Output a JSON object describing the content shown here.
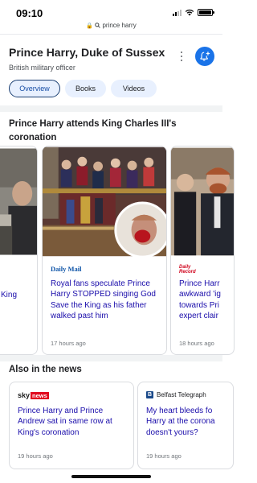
{
  "status_bar": {
    "time": "09:10",
    "battery_level": 1.0
  },
  "url_bar": {
    "query": "prince harry",
    "lock_glyph": "🔒"
  },
  "entity": {
    "title": "Prince Harry, Duke of Sussex",
    "subtitle": "British military officer",
    "chips": [
      {
        "label": "Overview",
        "selected": true
      },
      {
        "label": "Books",
        "selected": false
      },
      {
        "label": "Videos",
        "selected": false
      }
    ]
  },
  "top_stories": {
    "heading": "Prince Harry attends King Charles III's coronation",
    "cards": [
      {
        "source": "",
        "headline": "King",
        "time": ""
      },
      {
        "source": "Daily Mail",
        "headline": "Royal fans speculate Prince Harry STOPPED singing God Save the King as his father walked past him",
        "time": "17 hours ago"
      },
      {
        "source": "Daily Record",
        "source_line1": "Daily",
        "source_line2": "Record",
        "headline": "Prince Harr awkward 'ig towards Pri expert clair",
        "time": "18 hours ago"
      }
    ]
  },
  "also_in_news": {
    "heading": "Also in the news",
    "cards": [
      {
        "source_sky": "sky",
        "source_news": "news",
        "headline": "Prince Harry and Prince Andrew sat in same row at King's coronation",
        "time": "19 hours ago"
      },
      {
        "source_icon_letter": "B",
        "source": "Belfast Telegraph",
        "headline": "My heart bleeds fo Harry at the corona doesn't yours?",
        "time": "19 hours ago"
      }
    ]
  },
  "colors": {
    "accent": "#1a73e8",
    "link": "#1a0dab",
    "daily_mail_blue": "#0f55a8",
    "daily_record_red": "#d0021b",
    "sky_news_red": "#e10a1e",
    "belfast_blue": "#1b4a8a"
  },
  "icons": {
    "notify": "bell-plus-icon",
    "more": "more-vert-icon"
  }
}
